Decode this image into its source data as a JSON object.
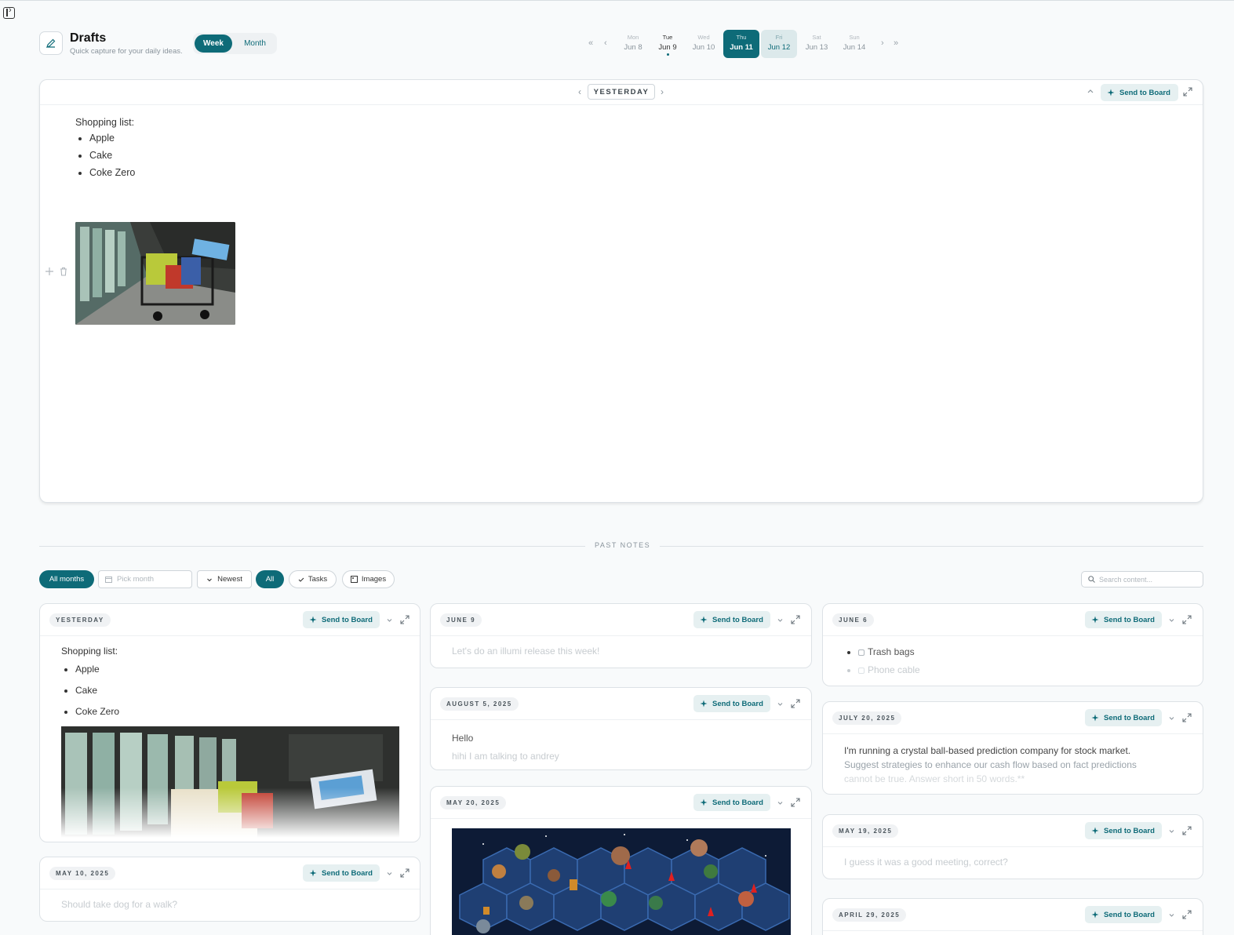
{
  "header": {
    "title": "Drafts",
    "subtitle": "Quick capture for your daily ideas.",
    "view_week": "Week",
    "view_month": "Month"
  },
  "week_days": [
    {
      "dow": "Mon",
      "date": "Jun 8"
    },
    {
      "dow": "Tue",
      "date": "Jun 9"
    },
    {
      "dow": "Wed",
      "date": "Jun 10"
    },
    {
      "dow": "Thu",
      "date": "Jun 11"
    },
    {
      "dow": "Fri",
      "date": "Jun 12"
    },
    {
      "dow": "Sat",
      "date": "Jun 13"
    },
    {
      "dow": "Sun",
      "date": "Jun 14"
    }
  ],
  "editor": {
    "day_label": "YESTERDAY",
    "send_label": "Send to Board",
    "list_title": "Shopping list:",
    "items": [
      "Apple",
      "Cake",
      "Coke Zero"
    ]
  },
  "past": {
    "label": "PAST NOTES",
    "all_months": "All months",
    "pick_month_placeholder": "Pick month",
    "sort": "Newest",
    "filter_all": "All",
    "filter_tasks": "Tasks",
    "filter_images": "Images",
    "search_placeholder": "Search content..."
  },
  "notes": {
    "send_label": "Send to Board",
    "c1": {
      "yesterday": {
        "date": "YESTERDAY",
        "title": "Shopping list:",
        "items": [
          "Apple",
          "Cake",
          "Coke Zero"
        ]
      },
      "may10": {
        "date": "MAY 10, 2025",
        "text": "Should take dog for a walk?"
      }
    },
    "c2": {
      "june9": {
        "date": "JUNE 9",
        "text": "Let's do an illumi release this week!"
      },
      "aug5": {
        "date": "AUGUST 5, 2025",
        "line1": "Hello",
        "line2": "hihi I am talking to andrey"
      },
      "may20": {
        "date": "MAY 20, 2025"
      }
    },
    "c3": {
      "june6": {
        "date": "JUNE 6",
        "items": [
          "Trash bags",
          "Phone cable"
        ]
      },
      "july20": {
        "date": "JULY 20, 2025",
        "line1": "I'm running a crystal ball-based prediction company for stock market.",
        "line2": "Suggest strategies to enhance our cash flow based on fact predictions",
        "line3": "cannot be true. Answer short in 50 words.**"
      },
      "may19": {
        "date": "MAY 19, 2025",
        "text": "I guess it was a good meeting, correct?"
      },
      "apr29": {
        "date": "APRIL 29, 2025"
      }
    }
  },
  "colors": {
    "accent": "#0e6b78",
    "accent_soft": "#e6f0f1",
    "background": "#f8fafb"
  }
}
